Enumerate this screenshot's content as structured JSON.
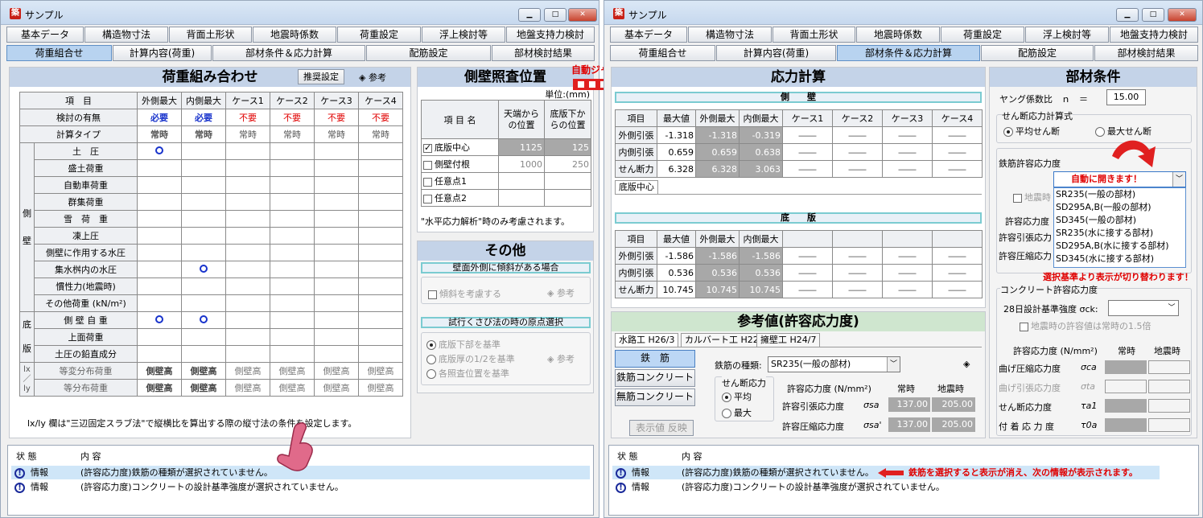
{
  "left": {
    "title": "サンプル",
    "tabs_row1": [
      "基本データ",
      "構造物寸法",
      "背面土形状",
      "地震時係数",
      "荷重設定",
      "浮上検討等",
      "地盤支持力検討"
    ],
    "tabs_row2": [
      "荷重組合せ",
      "計算内容(荷重)",
      "部材条件＆応力計算",
      "配筋設定",
      "部材検討結果"
    ],
    "active_tab": "荷重組合せ",
    "combo": {
      "heading": "荷重組み合わせ",
      "recommend_btn": "推奨設定",
      "ref_btn": "参考",
      "col_item": "項　目",
      "cols": [
        "外側最大",
        "内側最大",
        "ケース1",
        "ケース2",
        "ケース3",
        "ケース4"
      ],
      "row_use": {
        "label": "検討の有無",
        "values": [
          "必要",
          "必要",
          "不要",
          "不要",
          "不要",
          "不要"
        ]
      },
      "row_type": {
        "label": "計算タイプ",
        "values": [
          "常時",
          "常時",
          "常時",
          "常時",
          "常時",
          "常時"
        ]
      },
      "group_side": [
        "側",
        "壁"
      ],
      "group_bottom": [
        "底",
        "版"
      ],
      "group_ratio": [
        "lx",
        "／",
        "ly"
      ],
      "side_rows": [
        "土　圧",
        "盛土荷重",
        "自動車荷重",
        "群集荷重",
        "雪　荷　重",
        "凍上圧",
        "側壁に作用する水圧",
        "集水桝内の水圧",
        "慣性力(地震時)",
        "その他荷重 (kN/m²)"
      ],
      "bottom_rows": [
        "側 壁 自 重",
        "上面荷重",
        "土圧の鉛直成分"
      ],
      "ratio_rows": [
        {
          "label": "等変分布荷重",
          "values": [
            "側壁高",
            "側壁高",
            "側壁高",
            "側壁高",
            "側壁高",
            "側壁高"
          ]
        },
        {
          "label": "等分布荷重",
          "values": [
            "側壁高",
            "側壁高",
            "側壁高",
            "側壁高",
            "側壁高",
            "側壁高"
          ]
        }
      ],
      "note": "lx/ly 欄は\"三辺固定スラブ法\"で縦横比を算出する際の縦寸法の条件を設定します。"
    },
    "side_check": {
      "heading": "側壁照査位置",
      "unit": "単位:(mm)",
      "col_name": "項 目 名",
      "col_top": "天端からの位置",
      "col_bottom": "底版下からの位置",
      "rows": [
        {
          "name": "底版中心",
          "top": "1125",
          "bottom": "125",
          "checked": true
        },
        {
          "name": "側壁付根",
          "top": "1000",
          "bottom": "250",
          "checked": false
        },
        {
          "name": "任意点1",
          "top": "",
          "bottom": "",
          "checked": false
        },
        {
          "name": "任意点2",
          "top": "",
          "bottom": "",
          "checked": false
        }
      ],
      "note": "\"水平応力解析\"時のみ考慮されます。"
    },
    "other": {
      "heading": "その他",
      "sub1": "壁面外側に傾斜がある場合",
      "slope_check": "傾斜を考慮する",
      "ref": "参考",
      "sub2": "試行くさび法の時の原点選択",
      "radios": [
        "底版下部を基準",
        "底版厚の1/2を基準",
        "各照査位置を基準"
      ]
    },
    "status": {
      "col_state": "状 態",
      "col_content": "内 容",
      "rows": [
        {
          "state": "情報",
          "content": "(許容応力度)鉄筋の種類が選択されていません。"
        },
        {
          "state": "情報",
          "content": "(許容応力度)コンクリートの設計基準強度が選択されていません。"
        }
      ]
    },
    "callout_jump": "自動ジャンプ"
  },
  "right": {
    "title": "サンプル",
    "tabs_row1": [
      "基本データ",
      "構造物寸法",
      "背面土形状",
      "地震時係数",
      "荷重設定",
      "浮上検討等",
      "地盤支持力検討"
    ],
    "tabs_row2": [
      "荷重組合せ",
      "計算内容(荷重)",
      "部材条件＆応力計算",
      "配筋設定",
      "部材検討結果"
    ],
    "active_tab": "部材条件＆応力計算",
    "stress": {
      "heading": "応力計算",
      "wall_label": "側　　壁",
      "cols": [
        "項目",
        "最大値",
        "外側最大",
        "内側最大",
        "ケース1",
        "ケース2",
        "ケース3",
        "ケース4"
      ],
      "wall_rows": [
        {
          "label": "外側引張",
          "max": "-1.318",
          "outer": "-1.318",
          "inner": "-0.319"
        },
        {
          "label": "内側引張",
          "max": "0.659",
          "outer": "0.659",
          "inner": "0.638"
        },
        {
          "label": "せん断力",
          "max": "6.328",
          "outer": "6.328",
          "inner": "3.063"
        }
      ],
      "wall_tab": "底版中心",
      "bottom_label": "底　　版",
      "bottom_rows": [
        {
          "label": "外側引張",
          "max": "-1.586",
          "outer": "-1.586",
          "inner": "-1.586"
        },
        {
          "label": "内側引張",
          "max": "0.536",
          "outer": "0.536",
          "inner": "0.536"
        },
        {
          "label": "せん断力",
          "max": "10.745",
          "outer": "10.745",
          "inner": "10.745"
        }
      ],
      "dash": "――"
    },
    "ref": {
      "heading": "参考値(許容応力度)",
      "tabs": [
        "水路工 H26/3",
        "カルバート工 H22",
        "擁壁工 H24/7"
      ],
      "btns": [
        "鉄　筋",
        "鉄筋コンクリート",
        "無筋コンクリート"
      ],
      "apply_btn": "表示値 反映",
      "rebar_kind_label": "鉄筋の種類:",
      "rebar_kind_value": "SR235(一般の部材)",
      "shear_group": "せん断応力",
      "shear_radios": [
        "平均",
        "最大"
      ],
      "allow_label": "許容応力度 (N/mm²)",
      "normal": "常時",
      "seismic": "地震時",
      "tension_label": "許容引張応力度",
      "tension_sym": "σsa",
      "tension_values": [
        "137.00",
        "205.00"
      ],
      "comp_label": "許容圧縮応力度",
      "comp_sym": "σsa'",
      "comp_values": [
        "137.00",
        "205.00"
      ]
    },
    "member": {
      "heading": "部材条件",
      "young_label": "ヤング係数比　ｎ　＝",
      "young_value": "15.00",
      "shear_group": "せん断応力計算式",
      "shear_radios": [
        "平均せん断",
        "最大せん断"
      ],
      "rebar_allow_label": "鉄筋許容応力度",
      "dropdown_value": "自動に開きます！",
      "dropdown_options": [
        "SR235(一般の部材)",
        "SD295A,B(一般の部材)",
        "SD345(一般の部材)",
        "SR235(水に接する部材)",
        "SD295A,B(水に接する部材)",
        "SD345(水に接する部材)"
      ],
      "seismic_check": "地震時",
      "allow_label": "許容応力度",
      "tension_label": "許容引張応力",
      "comp_label": "許容圧縮応力",
      "switch_note": "選択基準より表示が切り替わります！",
      "concrete_group": "コンクリート許容応力度",
      "ck_label": "28日設計基準強度 σck:",
      "ck_check": "地震時の許容値は常時の1.5倍",
      "c_allow": "許容応力度 (N/mm²)",
      "c_normal": "常時",
      "c_seismic": "地震時",
      "c_rows": [
        {
          "label": "曲げ圧縮応力度",
          "sym": "σca"
        },
        {
          "label": "曲げ引張応力度",
          "sym": "σta"
        },
        {
          "label": "せん断応力度",
          "sym": "τa1"
        },
        {
          "label": "付 着 応 力 度",
          "sym": "τ0a"
        }
      ]
    },
    "status": {
      "col_state": "状 態",
      "col_content": "内 容",
      "rows": [
        {
          "state": "情報",
          "content": "(許容応力度)鉄筋の種類が選択されていません。"
        },
        {
          "state": "情報",
          "content": "(許容応力度)コンクリートの設計基準強度が選択されていません。"
        }
      ],
      "note": "鉄筋を選択すると表示が消え、次の情報が表示されます。"
    }
  },
  "colors": {
    "accent": "#c4d3e8",
    "active_tab": "#b8d3f0",
    "red": "#e00000",
    "blue": "#1833cc",
    "cell_gray": "#a8a8a8"
  }
}
